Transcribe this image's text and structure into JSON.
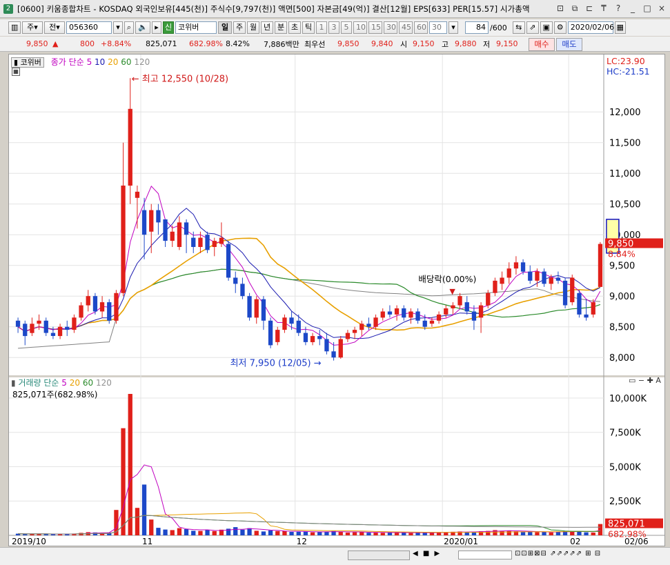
{
  "title": {
    "app_icon": "2",
    "text": "[0600] 키움종합차트 - KOSDAQ 외국인보유[445(천)] 주식수[9,797(천)] 액면[500] 자본금[49(억)] 결산[12월] EPS[633] PER[15.57] 시가총액",
    "buttons": [
      "⊡",
      "⧉",
      "⊏",
      "₸",
      "?",
      "_",
      "□",
      "×"
    ]
  },
  "toolbar": {
    "period_select": "주",
    "market_select": "전",
    "code": "056360",
    "sound_icon": "speaker-icon",
    "new_label": "신",
    "stock_name": "코위버",
    "period_tabs": [
      "일",
      "주",
      "월",
      "년",
      "분",
      "초",
      "틱"
    ],
    "minute_tabs": [
      "1",
      "3",
      "5",
      "10",
      "15",
      "30",
      "45",
      "60"
    ],
    "interval_value": "30",
    "count": "84",
    "count_total": "/600",
    "date": "2020/02/06"
  },
  "quote": {
    "price": "9,850",
    "change": "800",
    "change_pct": "+8.84%",
    "volume": "825,071",
    "volume_ratio": "682.98%",
    "turnover": "8.42%",
    "amount": "7,886백만",
    "best_ask_label": "최우선",
    "best_ask": "9,850",
    "best_bid": "9,840",
    "open_label": "시",
    "open": "9,150",
    "high_label": "고",
    "high": "9,880",
    "low_label": "저",
    "low": "9,150",
    "buy_label": "매수",
    "sell_label": "매도"
  },
  "price_panel": {
    "stock_tag": "코위버",
    "legend_title": "종가 단순",
    "ma_periods": [
      "5",
      "10",
      "20",
      "60",
      "120"
    ],
    "lc": "LC:23.90",
    "hc": "HC:-21.51",
    "high_note": "최고 12,550 (10/28)",
    "low_note": "최저 7,950 (12/05)",
    "dividend_note": "배당락(0.00%)",
    "y_ticks": [
      "12,000",
      "11,500",
      "11,000",
      "10,500",
      "10,000",
      "9,500",
      "9,000",
      "8,500",
      "8,000"
    ],
    "last_price": "9,850",
    "last_change": "8.84%"
  },
  "volume_panel": {
    "legend_title": "거래량 단순",
    "ma_periods": [
      "5",
      "20",
      "60",
      "120"
    ],
    "current": "825,071주(682.98%)",
    "y_ticks": [
      "10,000K",
      "7,500K",
      "5,000K",
      "2,500K"
    ],
    "last_volume": "825,071",
    "last_ratio": "682.98%"
  },
  "x_axis": {
    "labels": [
      "2019/10",
      "11",
      "12",
      "2020/01",
      "02"
    ],
    "last_date": "02/06"
  },
  "colors": {
    "up": "#e0201a",
    "down": "#1c48c8",
    "ma5": "#c000c0",
    "ma10": "#1a1ab0",
    "ma20": "#e8a000",
    "ma60": "#2a8a2a",
    "ma120": "#808080"
  },
  "chart_data": {
    "type": "candlestick",
    "price_ylim": [
      7800,
      12800
    ],
    "volume_ylim": [
      0,
      10500000
    ],
    "candles": [
      [
        8600,
        8650,
        8400,
        8500
      ],
      [
        8550,
        8600,
        8200,
        8350
      ],
      [
        8400,
        8650,
        8350,
        8550
      ],
      [
        8550,
        8700,
        8450,
        8600
      ],
      [
        8600,
        8650,
        8350,
        8400
      ],
      [
        8400,
        8500,
        8300,
        8350
      ],
      [
        8350,
        8550,
        8300,
        8500
      ],
      [
        8500,
        8600,
        8350,
        8450
      ],
      [
        8450,
        8700,
        8400,
        8650
      ],
      [
        8650,
        8900,
        8600,
        8850
      ],
      [
        8850,
        9100,
        8750,
        9000
      ],
      [
        9000,
        9050,
        8700,
        8750
      ],
      [
        8750,
        9000,
        8650,
        8900
      ],
      [
        8900,
        8950,
        8550,
        8600
      ],
      [
        8600,
        9100,
        8550,
        9050
      ],
      [
        9050,
        11500,
        9000,
        10800
      ],
      [
        10800,
        12550,
        10500,
        12050
      ],
      [
        10600,
        10800,
        10100,
        10700
      ],
      [
        10400,
        10600,
        9600,
        10000
      ],
      [
        10050,
        10500,
        9700,
        10400
      ],
      [
        10400,
        10500,
        10000,
        10200
      ],
      [
        10250,
        10250,
        9800,
        9900
      ],
      [
        9900,
        10150,
        9800,
        10050
      ],
      [
        9800,
        10300,
        9750,
        10200
      ],
      [
        10200,
        10250,
        9700,
        10000
      ],
      [
        9950,
        10050,
        9700,
        9800
      ],
      [
        9800,
        10050,
        9700,
        9950
      ],
      [
        10000,
        10050,
        9700,
        9750
      ],
      [
        9800,
        9950,
        9650,
        9900
      ],
      [
        9850,
        10200,
        9800,
        9950
      ],
      [
        9850,
        9900,
        9250,
        9300
      ],
      [
        9300,
        9400,
        9050,
        9200
      ],
      [
        9200,
        9300,
        8950,
        9000
      ],
      [
        9000,
        9050,
        8600,
        8650
      ],
      [
        8650,
        9000,
        8550,
        8950
      ],
      [
        8950,
        9000,
        8450,
        8600
      ],
      [
        8600,
        8650,
        8150,
        8200
      ],
      [
        8250,
        8500,
        8200,
        8450
      ],
      [
        8450,
        8700,
        8400,
        8650
      ],
      [
        8650,
        8750,
        8450,
        8550
      ],
      [
        8600,
        8700,
        8350,
        8400
      ],
      [
        8400,
        8500,
        8200,
        8250
      ],
      [
        8250,
        8400,
        8200,
        8350
      ],
      [
        8350,
        8450,
        8200,
        8300
      ],
      [
        8300,
        8400,
        8050,
        8100
      ],
      [
        8100,
        8250,
        7950,
        8000
      ],
      [
        8000,
        8350,
        7980,
        8300
      ],
      [
        8300,
        8450,
        8250,
        8400
      ],
      [
        8400,
        8500,
        8300,
        8450
      ],
      [
        8450,
        8600,
        8350,
        8550
      ],
      [
        8550,
        8650,
        8450,
        8500
      ],
      [
        8500,
        8700,
        8450,
        8650
      ],
      [
        8650,
        8800,
        8600,
        8750
      ],
      [
        8750,
        8850,
        8650,
        8700
      ],
      [
        8700,
        8850,
        8600,
        8800
      ],
      [
        8800,
        8850,
        8600,
        8650
      ],
      [
        8650,
        8800,
        8550,
        8750
      ],
      [
        8750,
        8800,
        8550,
        8600
      ],
      [
        8600,
        8700,
        8450,
        8500
      ],
      [
        8550,
        8650,
        8500,
        8600
      ],
      [
        8600,
        8750,
        8550,
        8700
      ],
      [
        8700,
        8850,
        8650,
        8800
      ],
      [
        8800,
        8900,
        8700,
        8850
      ],
      [
        8850,
        9050,
        8800,
        9000
      ],
      [
        8900,
        9000,
        8700,
        8750
      ],
      [
        8750,
        8850,
        8450,
        8600
      ],
      [
        8650,
        8900,
        8400,
        8850
      ],
      [
        8850,
        9100,
        8800,
        9050
      ],
      [
        9050,
        9300,
        9000,
        9250
      ],
      [
        9200,
        9400,
        9100,
        9300
      ],
      [
        9300,
        9550,
        9200,
        9450
      ],
      [
        9450,
        9650,
        9350,
        9550
      ],
      [
        9550,
        9600,
        9350,
        9400
      ],
      [
        9400,
        9500,
        9200,
        9250
      ],
      [
        9250,
        9450,
        9150,
        9400
      ],
      [
        9400,
        9450,
        9150,
        9200
      ],
      [
        9200,
        9350,
        9100,
        9300
      ],
      [
        9300,
        9400,
        9200,
        9250
      ],
      [
        9250,
        9300,
        8800,
        8850
      ],
      [
        8900,
        9350,
        8850,
        9300
      ],
      [
        9050,
        9100,
        8650,
        8700
      ],
      [
        8700,
        8950,
        8600,
        8650
      ],
      [
        8700,
        8950,
        8650,
        8900
      ],
      [
        9150,
        9880,
        9150,
        9850
      ]
    ],
    "volumes": [
      120000,
      90000,
      110000,
      100000,
      95000,
      85000,
      100000,
      90000,
      130000,
      180000,
      230000,
      210000,
      160000,
      200000,
      1850000,
      7800000,
      10300000,
      2000000,
      3700000,
      1150000,
      550000,
      420000,
      380000,
      520000,
      450000,
      330000,
      320000,
      380000,
      310000,
      410000,
      480000,
      600000,
      410000,
      520000,
      330000,
      280000,
      360000,
      310000,
      300000,
      250000,
      260000,
      280000,
      220000,
      240000,
      270000,
      310000,
      260000,
      200000,
      220000,
      250000,
      190000,
      210000,
      180000,
      200000,
      230000,
      190000,
      170000,
      190000,
      210000,
      200000,
      230000,
      220000,
      260000,
      280000,
      240000,
      260000,
      300000,
      320000,
      380000,
      330000,
      350000,
      290000,
      240000,
      270000,
      230000,
      260000,
      210000,
      280000,
      320000,
      260000,
      300000,
      220000,
      200000,
      825071
    ]
  }
}
